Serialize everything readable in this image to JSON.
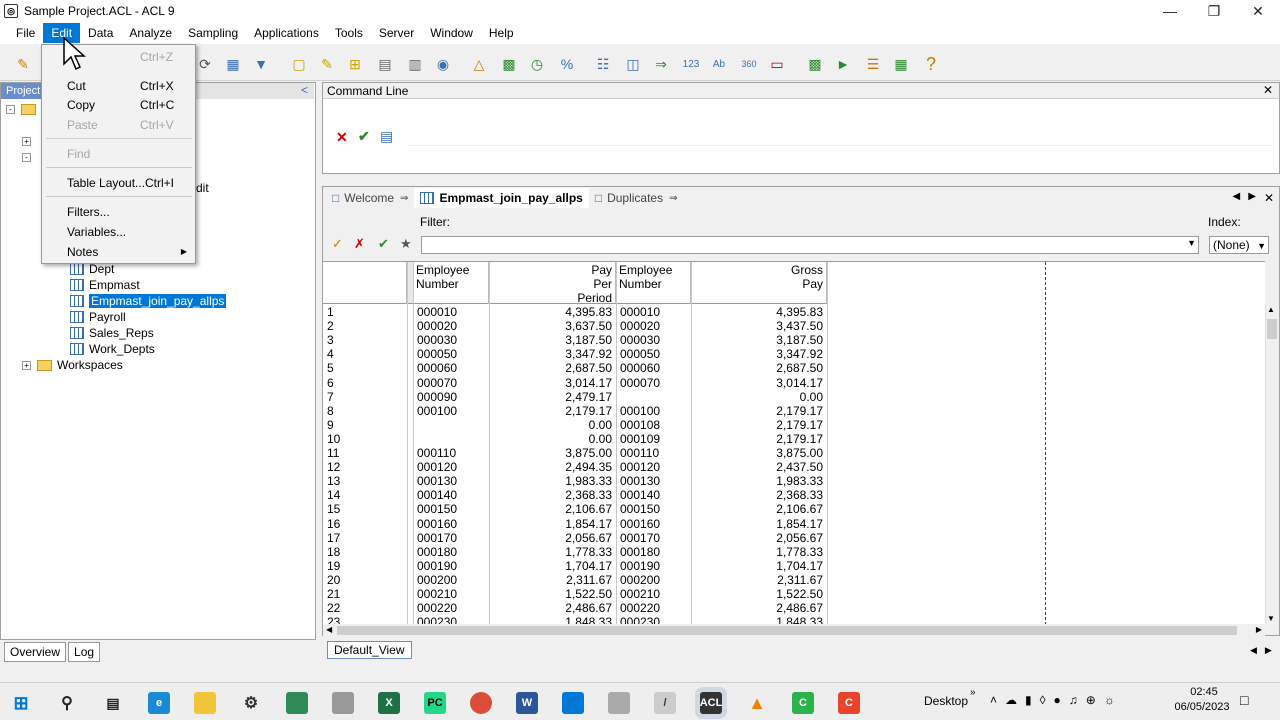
{
  "window": {
    "title": "Sample Project.ACL - ACL 9"
  },
  "menu": [
    "File",
    "Edit",
    "Data",
    "Analyze",
    "Sampling",
    "Applications",
    "Tools",
    "Server",
    "Window",
    "Help"
  ],
  "edit_menu": [
    {
      "label": "",
      "key": "Ctrl+Z",
      "disabled": true
    },
    {
      "label": "Cut",
      "key": "Ctrl+X",
      "disabled": false
    },
    {
      "label": "Copy",
      "key": "Ctrl+C",
      "disabled": false
    },
    {
      "label": "Paste",
      "key": "Ctrl+V",
      "disabled": true
    },
    {
      "label": "Find",
      "key": "",
      "disabled": true
    },
    {
      "label": "Table Layout...",
      "key": "Ctrl+I",
      "disabled": false
    },
    {
      "label": "Filters...",
      "key": "",
      "disabled": false
    },
    {
      "label": "Variables...",
      "key": "",
      "disabled": false
    },
    {
      "label": "Notes",
      "key": "",
      "disabled": false
    }
  ],
  "project": {
    "tab_label": "Project",
    "partial_text": "dit",
    "tables": [
      "Dept",
      "Empmast",
      "Empmast_join_pay_allps",
      "Payroll",
      "Sales_Reps",
      "Work_Depts"
    ],
    "selected": "Empmast_join_pay_allps",
    "workspaces": "Workspaces",
    "bottom_tabs": [
      "Overview",
      "Log"
    ]
  },
  "command_line": {
    "title": "Command Line"
  },
  "view": {
    "tabs": [
      "Welcome",
      "Empmast_join_pay_allps",
      "Duplicates"
    ],
    "selected_tab": "Empmast_join_pay_allps",
    "filter_label": "Filter:",
    "index_label": "Index:",
    "index_value": "(None)",
    "view_tab": "Default_View",
    "headers": [
      [
        "Employee",
        "Number"
      ],
      [
        "Pay",
        "Per",
        "Period"
      ],
      [
        "Employee",
        "Number"
      ],
      [
        "Gross",
        "Pay"
      ]
    ],
    "rows": [
      [
        "1",
        "000010",
        "4,395.83",
        "000010",
        "4,395.83"
      ],
      [
        "2",
        "000020",
        "3,637.50",
        "000020",
        "3,437.50"
      ],
      [
        "3",
        "000030",
        "3,187.50",
        "000030",
        "3,187.50"
      ],
      [
        "4",
        "000050",
        "3,347.92",
        "000050",
        "3,347.92"
      ],
      [
        "5",
        "000060",
        "2,687.50",
        "000060",
        "2,687.50"
      ],
      [
        "6",
        "000070",
        "3,014.17",
        "000070",
        "3,014.17"
      ],
      [
        "7",
        "000090",
        "2,479.17",
        "",
        "0.00"
      ],
      [
        "8",
        "000100",
        "2,179.17",
        "000100",
        "2,179.17"
      ],
      [
        "9",
        "",
        "0.00",
        "000108",
        "2,179.17"
      ],
      [
        "10",
        "",
        "0.00",
        "000109",
        "2,179.17"
      ],
      [
        "11",
        "000110",
        "3,875.00",
        "000110",
        "3,875.00"
      ],
      [
        "12",
        "000120",
        "2,494.35",
        "000120",
        "2,437.50"
      ],
      [
        "13",
        "000130",
        "1,983.33",
        "000130",
        "1,983.33"
      ],
      [
        "14",
        "000140",
        "2,368.33",
        "000140",
        "2,368.33"
      ],
      [
        "15",
        "000150",
        "2,106.67",
        "000150",
        "2,106.67"
      ],
      [
        "16",
        "000160",
        "1,854.17",
        "000160",
        "1,854.17"
      ],
      [
        "17",
        "000170",
        "2,056.67",
        "000170",
        "2,056.67"
      ],
      [
        "18",
        "000180",
        "1,778.33",
        "000180",
        "1,778.33"
      ],
      [
        "19",
        "000190",
        "1,704.17",
        "000190",
        "1,704.17"
      ],
      [
        "20",
        "000200",
        "2,311.67",
        "000200",
        "2,311.67"
      ],
      [
        "21",
        "000210",
        "1,522.50",
        "000210",
        "1,522.50"
      ],
      [
        "22",
        "000220",
        "2,486.67",
        "000220",
        "2,486.67"
      ],
      [
        "23",
        "000230",
        "1,848.33",
        "000230",
        "1,848.33"
      ]
    ]
  },
  "taskbar": {
    "desktop_label": "Desktop",
    "time": "02:45",
    "date": "06/05/2023"
  }
}
